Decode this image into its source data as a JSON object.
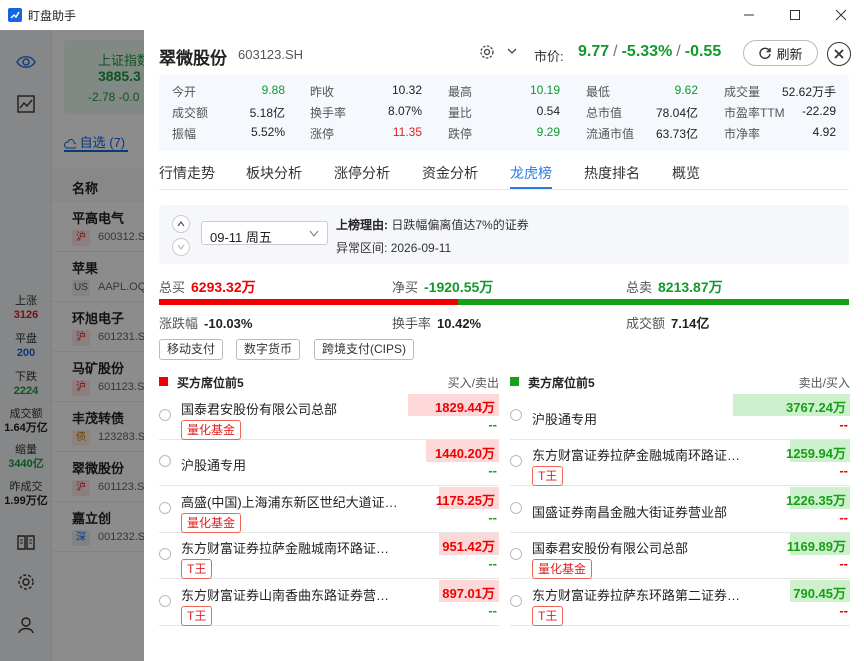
{
  "window": {
    "title": "盯盘助手",
    "min": "—",
    "max": "☐",
    "close": "✕"
  },
  "background": {
    "index": {
      "name": "上证指数",
      "price": "3885.3",
      "change": "-2.78  -0.0"
    },
    "watchlist_tab": "自选 (7)",
    "col_name": "名称",
    "stats": [
      {
        "label": "上涨",
        "value": "3126",
        "color": "#d22"
      },
      {
        "label": "平盘",
        "value": "200",
        "color": "#1565e0"
      },
      {
        "label": "下跌",
        "value": "2224",
        "color": "#1a9a3c"
      },
      {
        "label": "成交额",
        "value": "1.64万亿",
        "color": "#222"
      },
      {
        "label": "缩量",
        "value": "3440亿",
        "color": "#1a9a3c"
      },
      {
        "label": "昨成交",
        "value": "1.99万亿",
        "color": "#222"
      }
    ],
    "rows": [
      {
        "name": "平高电气",
        "tag": "沪",
        "code": "600312.S"
      },
      {
        "name": "苹果",
        "tag": "US",
        "code": "AAPL.OQ"
      },
      {
        "name": "环旭电子",
        "tag": "沪",
        "code": "601231.S"
      },
      {
        "name": "马矿股份",
        "tag": "沪",
        "code": "601123.S"
      },
      {
        "name": "丰茂转债",
        "tag": "债",
        "code": "123283.S"
      },
      {
        "name": "翠微股份",
        "tag": "沪",
        "code": "601123.S"
      },
      {
        "name": "嘉立创",
        "tag": "深",
        "code": "001232.S"
      }
    ]
  },
  "header": {
    "name": "翠微股份",
    "code": "603123.SH",
    "price_label": "市价:",
    "price": "9.77",
    "sep": "/",
    "pct": "-5.33%",
    "chg": "-0.55",
    "refresh_label": "刷新"
  },
  "quote": {
    "row1": [
      {
        "label": "今开",
        "value": "9.88",
        "color": "#119a2b"
      },
      {
        "label": "昨收",
        "value": "10.32",
        "color": "#222"
      },
      {
        "label": "最高",
        "value": "10.19",
        "color": "#119a2b"
      },
      {
        "label": "最低",
        "value": "9.62",
        "color": "#119a2b"
      },
      {
        "label": "成交量",
        "value": "52.62万手",
        "color": "#222"
      }
    ],
    "row2": [
      {
        "label": "成交额",
        "value": "5.18亿",
        "color": "#222"
      },
      {
        "label": "换手率",
        "value": "8.07%",
        "color": "#222"
      },
      {
        "label": "量比",
        "value": "0.54",
        "color": "#222"
      },
      {
        "label": "总市值",
        "value": "78.04亿",
        "color": "#222"
      },
      {
        "label": "市盈率TTM",
        "value": "-22.29",
        "color": "#222"
      }
    ],
    "row3": [
      {
        "label": "振幅",
        "value": "5.52%",
        "color": "#222"
      },
      {
        "label": "涨停",
        "value": "11.35",
        "color": "#e02020"
      },
      {
        "label": "跌停",
        "value": "9.29",
        "color": "#119a2b"
      },
      {
        "label": "流通市值",
        "value": "63.73亿",
        "color": "#222"
      },
      {
        "label": "市净率",
        "value": "4.92",
        "color": "#222"
      }
    ]
  },
  "tabs": [
    "行情走势",
    "板块分析",
    "涨停分析",
    "资金分析",
    "龙虎榜",
    "热度排名",
    "概览"
  ],
  "active_tab": 4,
  "lhb": {
    "date": "09-11 周五",
    "reason_label": "上榜理由:",
    "reason": "日跌幅偏离值达7%的证券",
    "range_label": "异常区间:",
    "range": "2026-09-11"
  },
  "totals": {
    "buy_label": "总买",
    "buy": "6293.32万",
    "net_label": "净买",
    "net": "-1920.55万",
    "sell_label": "总卖",
    "sell": "8213.87万",
    "buy_fraction": 0.434
  },
  "stats": {
    "pct_label": "涨跌幅",
    "pct": "-10.03%",
    "turnover_label": "换手率",
    "turnover": "10.42%",
    "amount_label": "成交额",
    "amount": "7.14亿"
  },
  "concepts": [
    "移动支付",
    "数字货币",
    "跨境支付(CIPS)"
  ],
  "buy_section": {
    "title": "买方席位前5",
    "col": "买入/卖出",
    "color": "#f00000"
  },
  "sell_section": {
    "title": "卖方席位前5",
    "col": "卖出/买入",
    "color": "#15a016"
  },
  "buyers": [
    {
      "name": "国泰君安股份有限公司总部",
      "badge": "量化基金",
      "amount": "1829.44万",
      "other": "--",
      "ratio": 0.35
    },
    {
      "name": "沪股通专用",
      "badge": "",
      "amount": "1440.20万",
      "other": "--",
      "ratio": 0.28
    },
    {
      "name": "高盛(中国)上海浦东新区世纪大道证券营业部",
      "badge": "量化基金",
      "amount": "1175.25万",
      "other": "--",
      "ratio": 0.23
    },
    {
      "name": "东方财富证券拉萨金融城南环路证券营业部",
      "badge": "T王",
      "amount": "951.42万",
      "other": "--",
      "ratio": 0.19
    },
    {
      "name": "东方财富证券山南香曲东路证券营业部",
      "badge": "T王",
      "amount": "897.01万",
      "other": "--",
      "ratio": 0.18
    }
  ],
  "sellers": [
    {
      "name": "沪股通专用",
      "badge": "",
      "amount": "3767.24万",
      "other": "--",
      "ratio": 0.45
    },
    {
      "name": "东方财富证券拉萨金融城南环路证券营业部",
      "badge": "T王",
      "amount": "1259.94万",
      "other": "--",
      "ratio": 0.15
    },
    {
      "name": "国盛证券南昌金融大街证券营业部",
      "badge": "",
      "amount": "1226.35万",
      "other": "--",
      "ratio": 0.15
    },
    {
      "name": "国泰君安股份有限公司总部",
      "badge": "量化基金",
      "amount": "1169.89万",
      "other": "--",
      "ratio": 0.14
    },
    {
      "name": "东方财富证券拉萨东环路第二证券营业部",
      "badge": "T王",
      "amount": "790.45万",
      "other": "--",
      "ratio": 0.09
    }
  ]
}
